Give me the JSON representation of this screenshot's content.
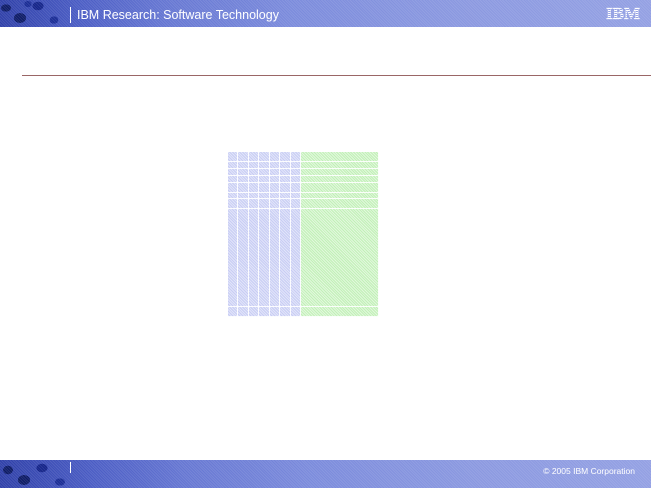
{
  "header": {
    "title": "IBM Research: Software Technology",
    "logo_text": "IBM"
  },
  "footer": {
    "copyright": "© 2005 IBM Corporation"
  },
  "colors": {
    "band_dark": "#0c1a66",
    "band_light": "#93a0e3",
    "rule": "#9a6666",
    "table_blue": "#c8cdf4",
    "table_green": "#c2f0b8"
  },
  "table": {
    "rows": 9,
    "blue_columns": 7,
    "green_columns": 1
  }
}
